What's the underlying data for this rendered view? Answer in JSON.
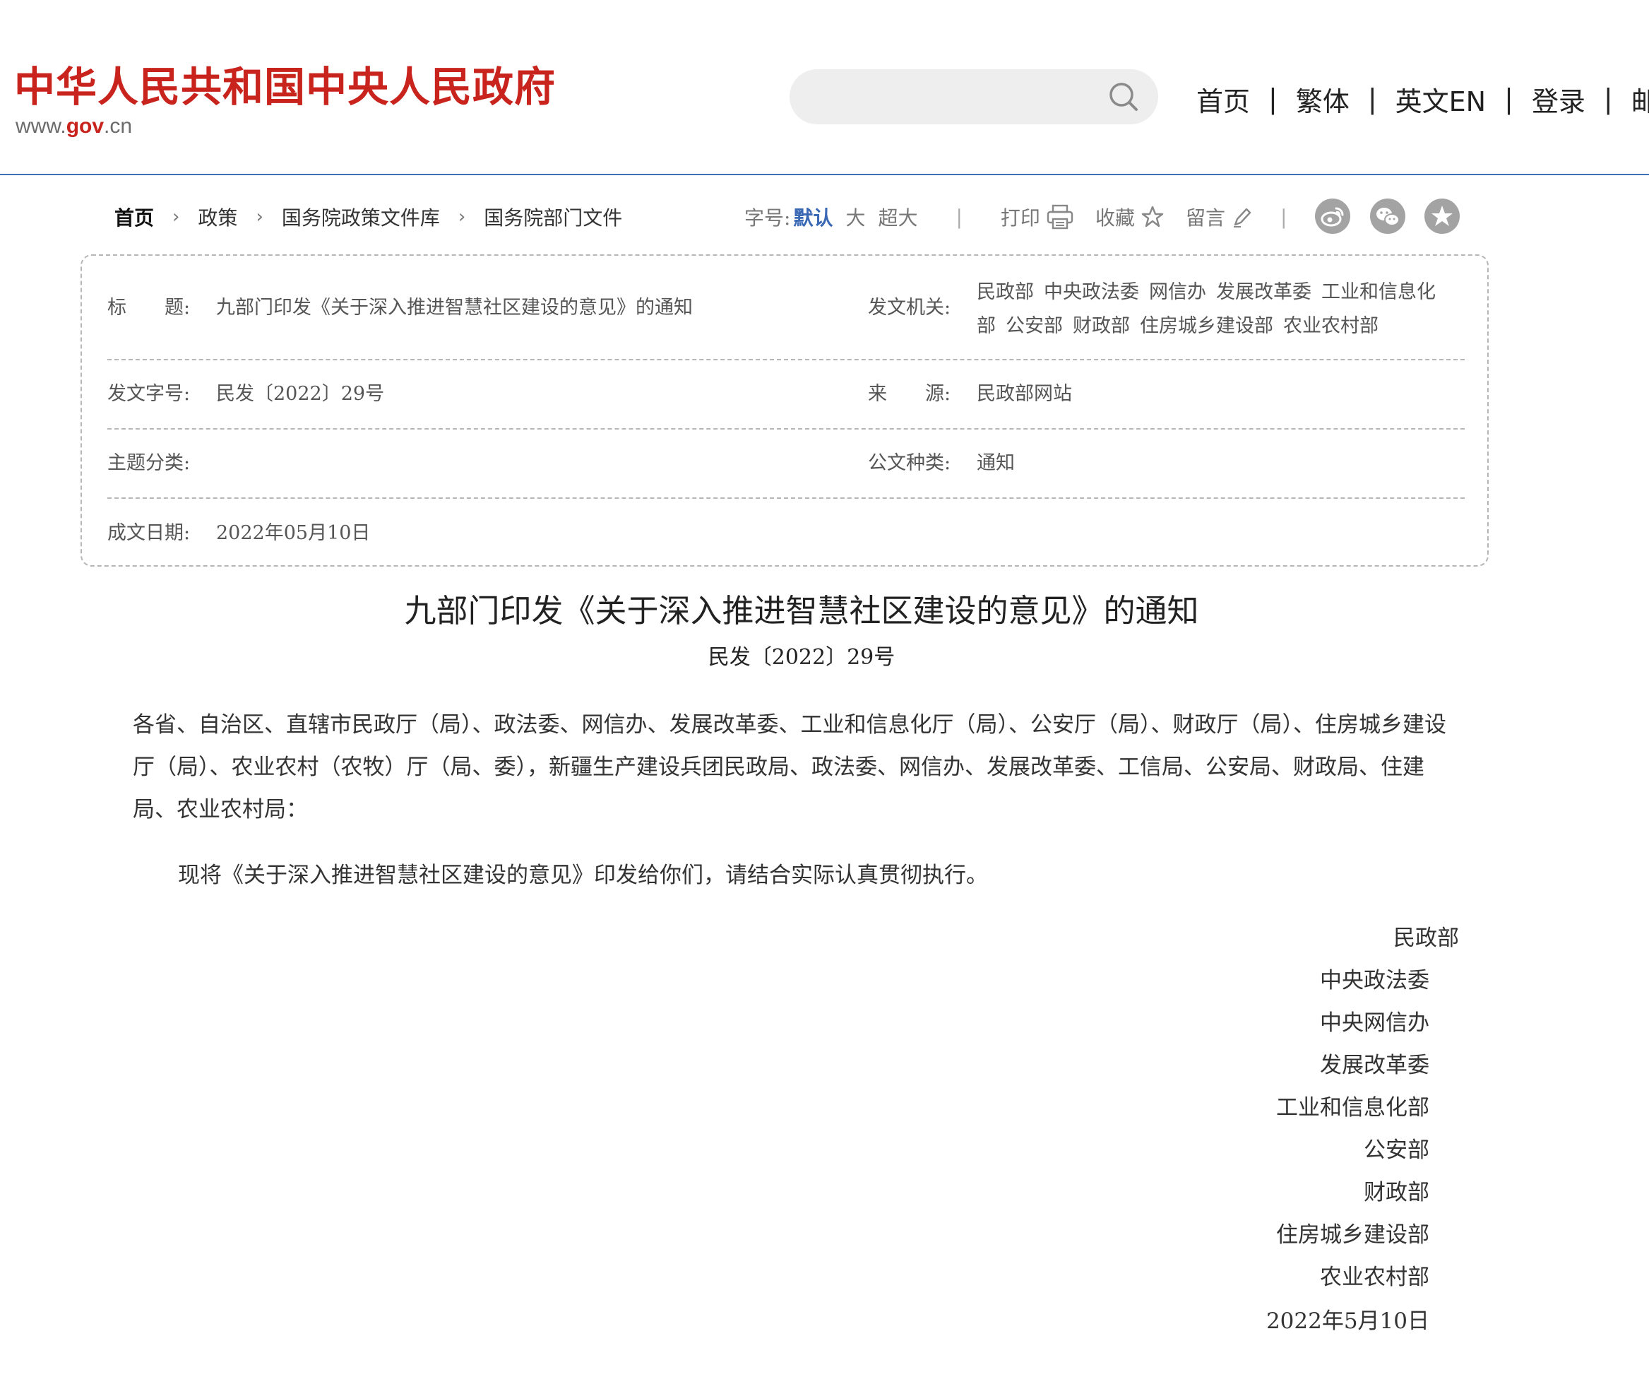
{
  "header": {
    "site_name": "中华人民共和国中央人民政府",
    "site_url_prefix": "www.",
    "site_url_gov": "gov",
    "site_url_suffix": ".cn",
    "search_placeholder": "",
    "nav": [
      "首页",
      "繁体",
      "英文EN",
      "登录",
      "邮箱"
    ],
    "nav_separator": "|"
  },
  "breadcrumb": {
    "items": [
      "首页",
      "政策",
      "国务院政策文件库",
      "国务院部门文件"
    ],
    "separator": "›"
  },
  "toolbar": {
    "font_size_label": "字号:",
    "font_size_options": [
      "默认",
      "大",
      "超大"
    ],
    "print_label": "打印",
    "favorite_label": "收藏",
    "comment_label": "留言",
    "divider": "|",
    "share_icons": [
      "weibo-icon",
      "wechat-icon",
      "star-icon"
    ]
  },
  "info": {
    "title_label": "标　　题:",
    "title_value": "九部门印发《关于深入推进智慧社区建设的意见》的通知",
    "issuer_label": "发文机关:",
    "issuers": [
      "民政部",
      "中央政法委",
      "网信办",
      "发展改革委",
      "工业和信息化部",
      "公安部",
      "财政部",
      "住房城乡建设部",
      "农业农村部"
    ],
    "doc_number_label": "发文字号:",
    "doc_number_value": "民发〔2022〕29号",
    "source_label": "来　　源:",
    "source_value": "民政部网站",
    "topic_label": "主题分类:",
    "topic_value": "",
    "doc_type_label": "公文种类:",
    "doc_type_value": "通知",
    "date_label": "成文日期:",
    "date_value": "2022年05月10日"
  },
  "article": {
    "title": "九部门印发《关于深入推进智慧社区建设的意见》的通知",
    "doc_number": "民发〔2022〕29号",
    "salutation": "各省、自治区、直辖市民政厅（局）、政法委、网信办、发展改革委、工业和信息化厅（局）、公安厅（局）、财政厅（局）、住房城乡建设厅（局）、农业农村（农牧）厅（局、委），新疆生产建设兵团民政局、政法委、网信办、发展改革委、工信局、公安局、财政局、住建局、农业农村局：",
    "body": "现将《关于深入推进智慧社区建设的意见》印发给你们，请结合实际认真贯彻执行。",
    "signatories": [
      "民政部",
      "中央政法委",
      "中央网信办",
      "发展改革委",
      "工业和信息化部",
      "公安部",
      "财政部",
      "住房城乡建设部",
      "农业农村部"
    ],
    "date": "2022年5月10日"
  },
  "colors": {
    "brand_red": "#c8231c",
    "header_rule_blue": "#3f6fb5",
    "active_font_size_blue": "#3a68b5",
    "share_icon_gray": "#a3a3a3"
  }
}
